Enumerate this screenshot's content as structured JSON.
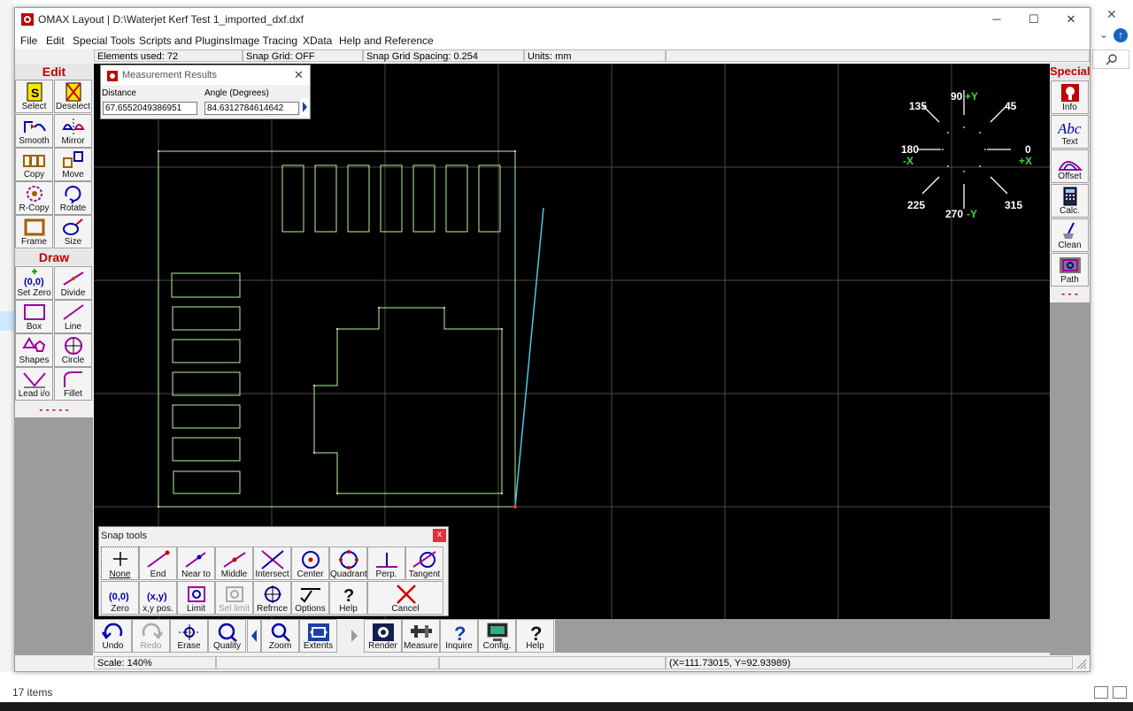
{
  "window": {
    "title": "OMAX Layout | D:\\Waterjet Kerf Test 1_imported_dxf.dxf",
    "minimize": "─",
    "maximize": "☐",
    "close": "✕"
  },
  "menu": [
    "File",
    "Edit",
    "Special Tools",
    "Scripts and Plugins",
    "Image Tracing",
    "XData",
    "Help and Reference"
  ],
  "info_bar": {
    "elements": "Elements used: 72",
    "snap_grid": "Snap Grid: OFF",
    "snap_spacing": "Snap Grid Spacing: 0.254",
    "units": "Units: mm"
  },
  "edit_palette": {
    "title": "Edit",
    "tools": [
      "Select",
      "Deselect",
      "Smooth",
      "Mirror",
      "Copy",
      "Move",
      "R-Copy",
      "Rotate",
      "Frame",
      "Size"
    ]
  },
  "draw_palette": {
    "title": "Draw",
    "tools": [
      "Set Zero",
      "Divide",
      "Box",
      "Line",
      "Shapes",
      "Circle",
      "Lead i/o",
      "Fillet"
    ],
    "more": "- - - - -"
  },
  "special_palette": {
    "title": "Special",
    "tools": [
      "Info",
      "Text",
      "Offset",
      "Calc.",
      "Clean",
      "Path"
    ],
    "more": "- - -"
  },
  "measurement": {
    "title": "Measurement Results",
    "distance_label": "Distance",
    "angle_label": "Angle (Degrees)",
    "distance_value": "67.6552049386951",
    "angle_value": "84.6312784614642"
  },
  "compass": {
    "labels": [
      "135",
      "90",
      "+Y",
      "45",
      "180",
      "-X",
      "0",
      "+X",
      "225",
      "270",
      "-Y",
      "315"
    ]
  },
  "snap_tools": {
    "title": "Snap tools",
    "close": "x",
    "row1": [
      "None",
      "End",
      "Near to",
      "Middle",
      "Intersect",
      "Center",
      "Quadrant",
      "Perp.",
      "Tangent"
    ],
    "row2": [
      "Zero",
      "x,y pos.",
      "Limit",
      "Sel limit",
      "Refrnce",
      "Options",
      "Help",
      "Cancel"
    ]
  },
  "bottom_toolbar": [
    "Undo",
    "Redo",
    "Erase",
    "Quality",
    "Zoom",
    "Extents",
    "Render",
    "Measure",
    "Inquire",
    "Config.",
    "Help"
  ],
  "status": {
    "scale": "Scale: 140%",
    "coords": "(X=111.73015, Y=92.93989)"
  },
  "background": {
    "items_count": "17 items"
  },
  "colors": {
    "canvas": "#000000",
    "geometry": "#b6f5a0",
    "measure_line": "#4fc7e8",
    "grid": "#4a4a4a",
    "palette_title": "#c00000"
  }
}
